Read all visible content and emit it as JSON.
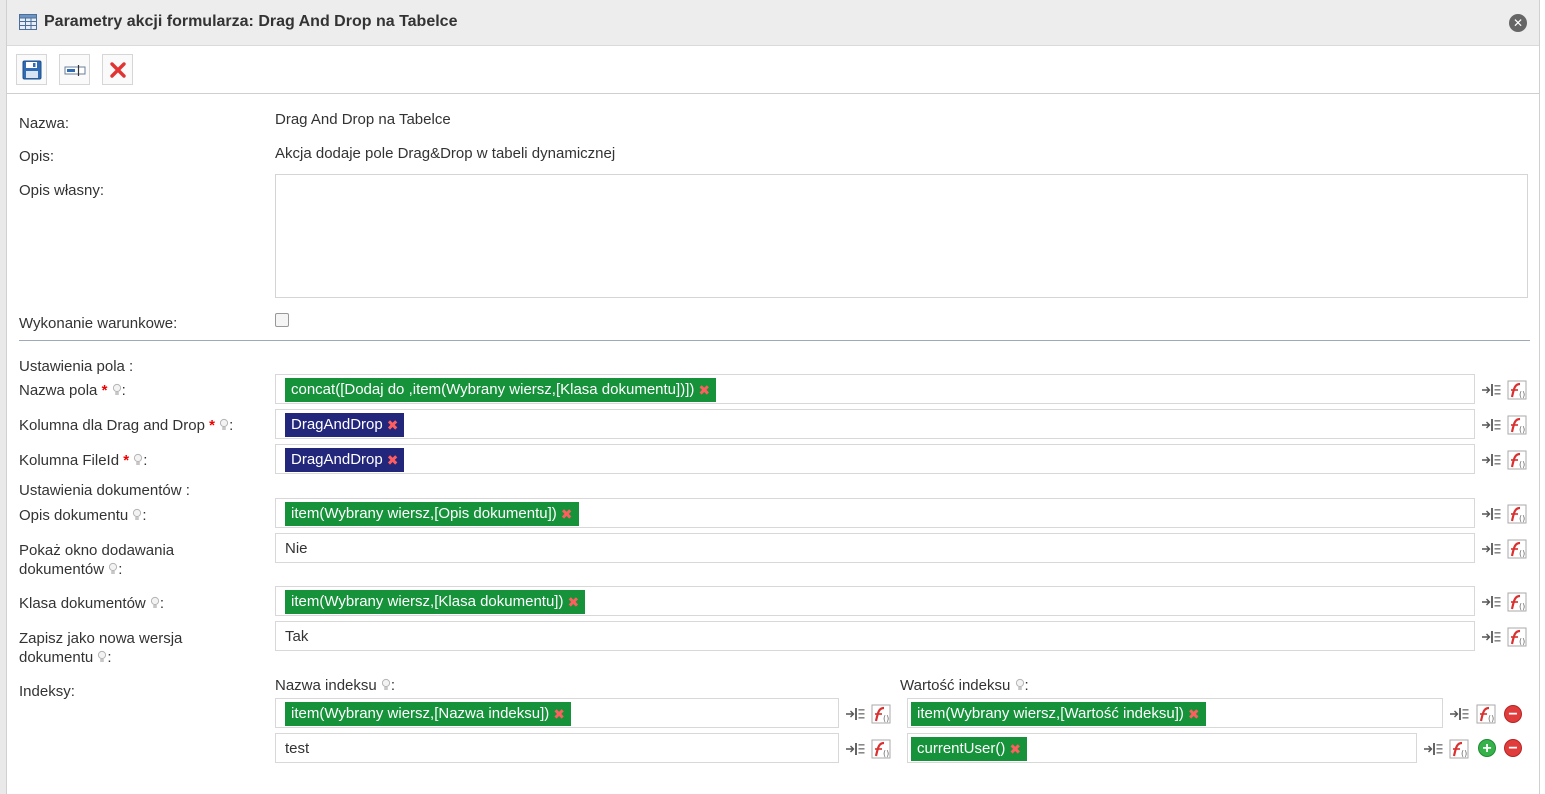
{
  "dialog": {
    "title": "Parametry akcji formularza: Drag And Drop na Tabelce",
    "close_label": "✕"
  },
  "form": {
    "name_label": "Nazwa:",
    "name_value": "Drag And Drop na Tabelce",
    "desc_label": "Opis:",
    "desc_value": "Akcja dodaje pole Drag&Drop w tabeli dynamicznej",
    "own_desc_label": "Opis własny:",
    "own_desc_value": "",
    "conditional_label": "Wykonanie warunkowe:",
    "conditional_checked": false
  },
  "field_settings": {
    "header": "Ustawienia pola :",
    "field_name": {
      "label": "Nazwa pola",
      "value": "concat([Dodaj do ,item(Wybrany wiersz,[Klasa dokumentu])])"
    },
    "dnd_column": {
      "label": "Kolumna dla Drag and Drop",
      "value": "DragAndDrop"
    },
    "fileid_column": {
      "label": "Kolumna FileId",
      "value": "DragAndDrop"
    }
  },
  "doc_settings": {
    "header": "Ustawienia dokumentów :",
    "doc_desc": {
      "label": "Opis dokumentu",
      "value": "item(Wybrany wiersz,[Opis dokumentu])"
    },
    "show_window": {
      "label_line1": "Pokaż okno dodawania",
      "label_line2": "dokumentów",
      "value": "Nie"
    },
    "doc_class": {
      "label": "Klasa dokumentów",
      "value": "item(Wybrany wiersz,[Klasa dokumentu])"
    },
    "new_version": {
      "label_line1": "Zapisz jako nowa wersja",
      "label_line2": "dokumentu",
      "value": "Tak"
    }
  },
  "indexes": {
    "label": "Indeksy:",
    "name_header": "Nazwa indeksu",
    "value_header": "Wartość indeksu",
    "rows": [
      {
        "name": "item(Wybrany wiersz,[Nazwa indeksu])",
        "value": "item(Wybrany wiersz,[Wartość indeksu])"
      },
      {
        "name": "test",
        "value": "currentUser()"
      }
    ]
  },
  "colon": ":",
  "req_mark": "*",
  "tag_remove": "✖",
  "minus_symbol": "−",
  "plus_symbol": "+",
  "colors": {
    "green_tag": "#15923a",
    "navy_tag": "#22277c",
    "remove_x": "#ff5e5e"
  }
}
